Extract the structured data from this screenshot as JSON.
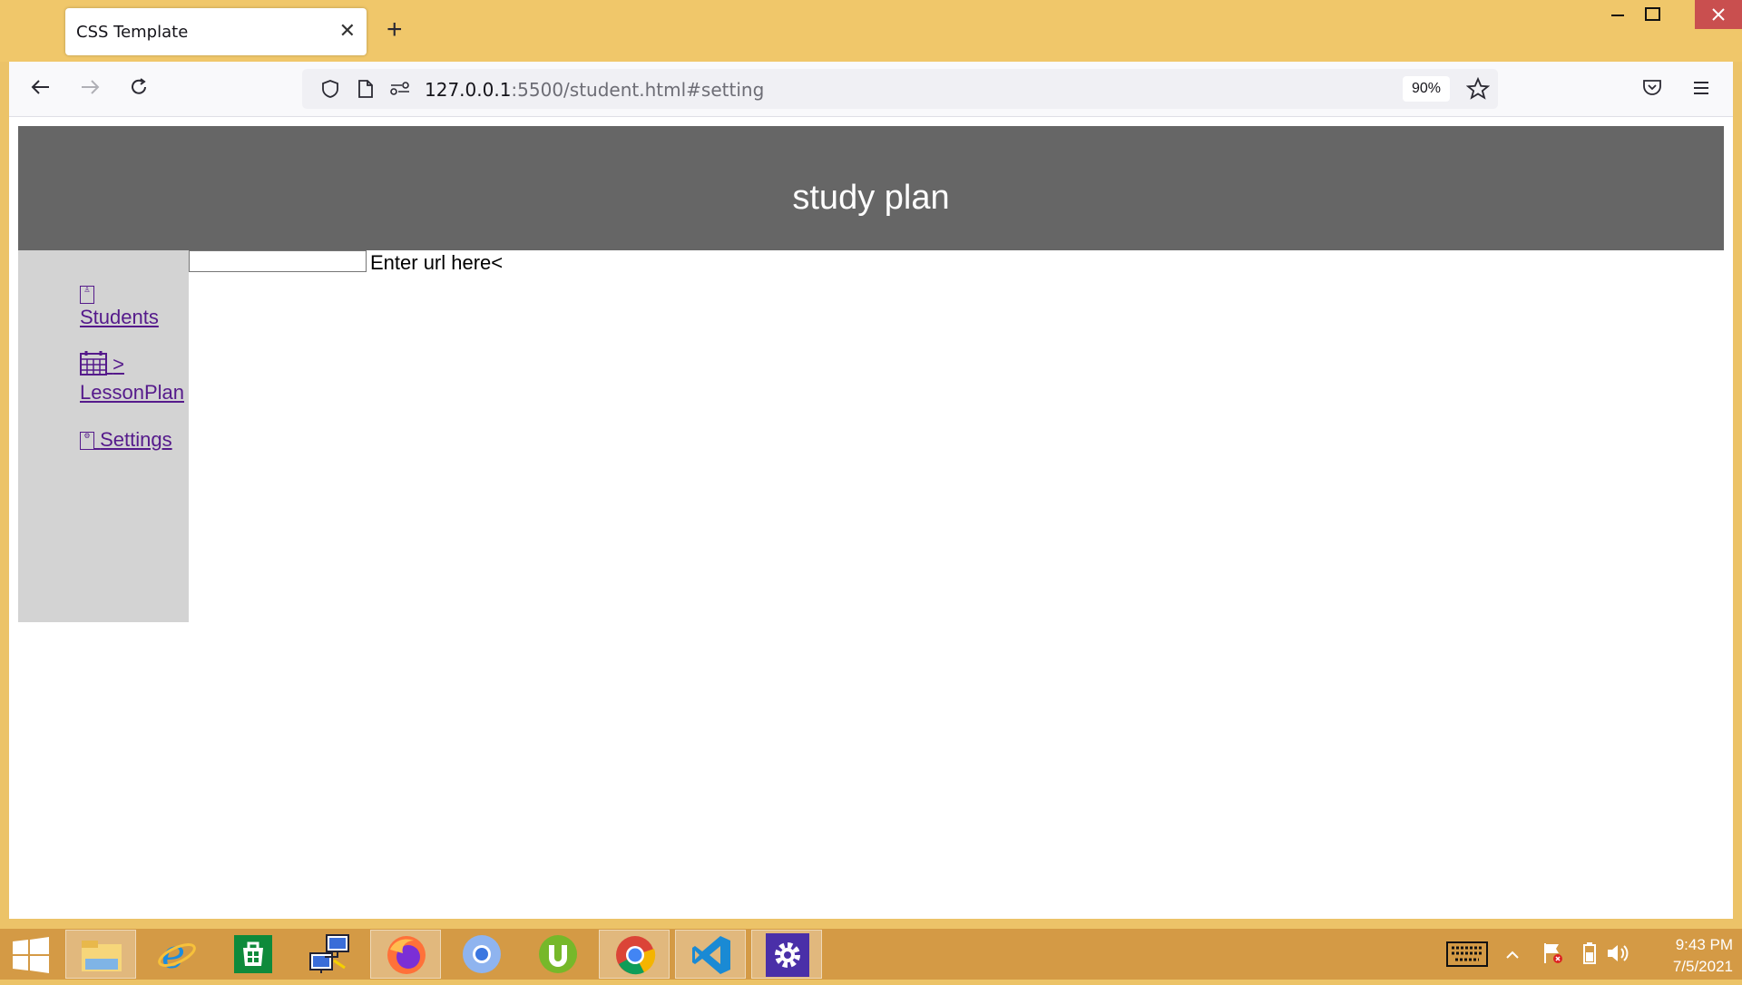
{
  "browser": {
    "tab_title": "CSS Template",
    "tab_close": "✕",
    "new_tab": "+",
    "url_host": "127.0.0.1",
    "url_rest": ":5500/student.html#setting",
    "zoom": "90%"
  },
  "page": {
    "title": "study plan",
    "sidebar": {
      "students": "Students",
      "lessonplan_arrow": ">",
      "lessonplan": "LessonPlan",
      "settings": "Settings"
    },
    "url_input_value": "",
    "enter_label": "Enter url here<"
  },
  "taskbar": {
    "apps": [
      "windows-start",
      "file-explorer",
      "internet-explorer",
      "store",
      "network",
      "firefox",
      "chromium",
      "utorrent",
      "chrome",
      "vscode",
      "settings"
    ],
    "time": "9:43 PM",
    "date": "7/5/2021"
  }
}
